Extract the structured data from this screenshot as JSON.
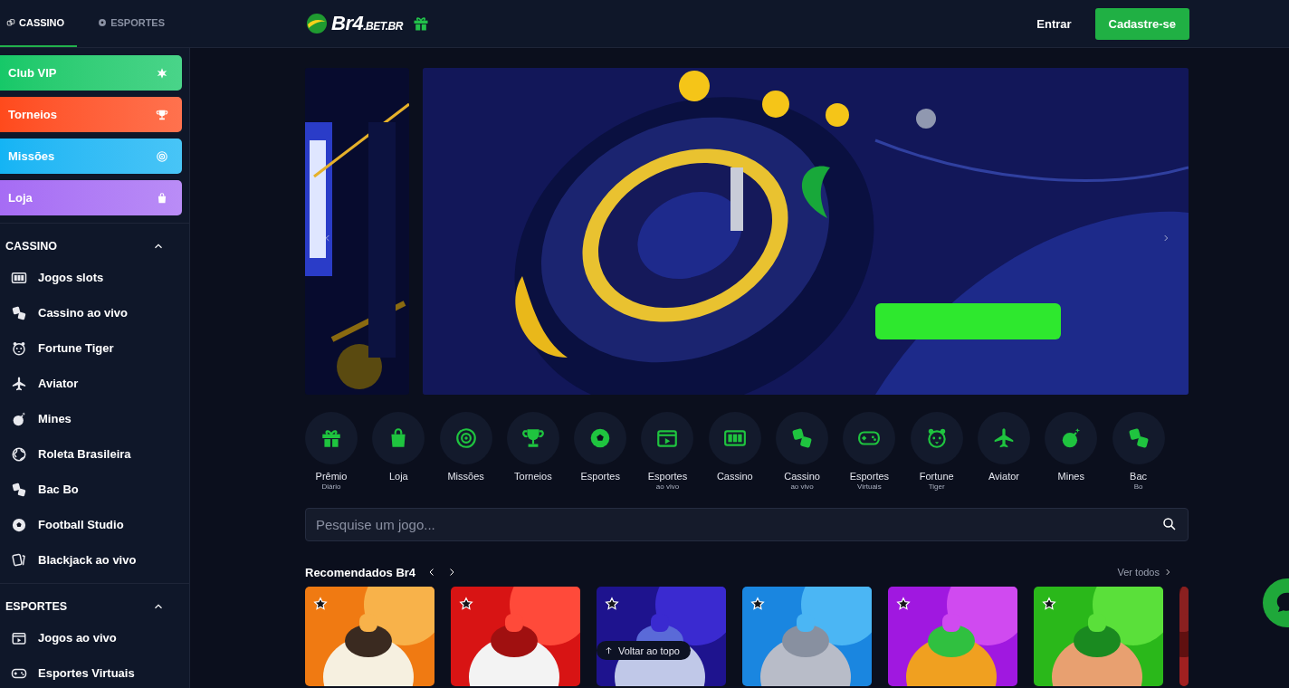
{
  "header": {
    "tabs": [
      {
        "label": "CASSINO",
        "selected": true
      },
      {
        "label": "ESPORTES",
        "selected": false
      }
    ],
    "logo": {
      "main": "Br4",
      "suffix": ".BET.BR"
    },
    "login": "Entrar",
    "signup": "Cadastre-se"
  },
  "sidebar": {
    "promos": [
      {
        "label": "Club VIP",
        "color": "#16c868"
      },
      {
        "label": "Torneios",
        "color": "#ff4a1c"
      },
      {
        "label": "Missões",
        "color": "#14b4f4"
      },
      {
        "label": "Loja",
        "color": "#a66cf4"
      }
    ],
    "sections": [
      {
        "title": "CASSINO",
        "expanded": true,
        "items": [
          "Jogos slots",
          "Cassino ao vivo",
          "Fortune Tiger",
          "Aviator",
          "Mines",
          "Roleta Brasileira",
          "Bac Bo",
          "Football Studio",
          "Blackjack ao vivo"
        ]
      },
      {
        "title": "ESPORTES",
        "expanded": true,
        "items": [
          "Jogos ao vivo",
          "Esportes Virtuais"
        ]
      }
    ]
  },
  "quick_links": [
    {
      "label": "Prêmio",
      "sublabel": "Diário"
    },
    {
      "label": "Loja"
    },
    {
      "label": "Missões"
    },
    {
      "label": "Torneios"
    },
    {
      "label": "Esportes"
    },
    {
      "label": "Esportes",
      "sublabel": "ao vivo"
    },
    {
      "label": "Cassino"
    },
    {
      "label": "Cassino",
      "sublabel": "ao vivo"
    },
    {
      "label": "Esportes",
      "sublabel": "Virtuais"
    },
    {
      "label": "Fortune",
      "sublabel": "Tiger"
    },
    {
      "label": "Aviator"
    },
    {
      "label": "Mines"
    },
    {
      "label": "Bac",
      "sublabel": "Bo"
    }
  ],
  "search": {
    "placeholder": "Pesquise um jogo..."
  },
  "recommended": {
    "title": "Recomendados Br4",
    "see_all": "Ver todos"
  },
  "back_to_top": "Voltar ao topo"
}
